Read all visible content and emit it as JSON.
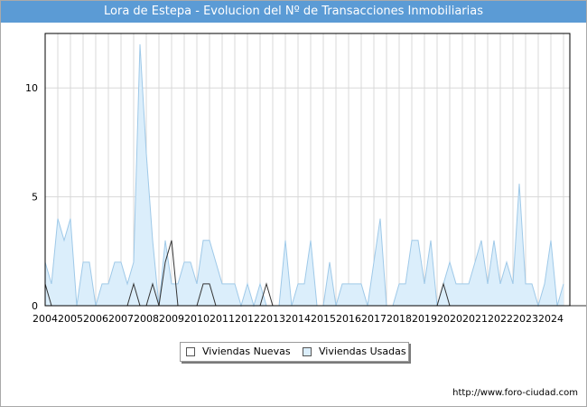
{
  "colors": {
    "title_bar": "#5b9bd5",
    "nuevas_line": "#333333",
    "usadas_fill": "#dbeefb",
    "usadas_line": "#9fc9e8",
    "grid": "#d8d8d8"
  },
  "chart_data": {
    "type": "area",
    "title": "Lora de Estepa - Evolucion del Nº de Transacciones Inmobiliarias",
    "xlabel": "",
    "ylabel": "",
    "ylim": [
      0,
      12.5
    ],
    "xlim": [
      2004,
      2024.75
    ],
    "grid": true,
    "legend_position": "bottom-center",
    "y_ticks": [
      "0",
      "5",
      "10"
    ],
    "x_ticks": [
      "2004",
      "2005",
      "2006",
      "2007",
      "2008",
      "2009",
      "2010",
      "2011",
      "2012",
      "2013",
      "2014",
      "2015",
      "2016",
      "2017",
      "2018",
      "2019",
      "2020",
      "2021",
      "2022",
      "2023",
      "2024"
    ],
    "x_start_year": 2004,
    "periods_per_year": 4,
    "series": [
      {
        "name": "Viviendas Nuevas",
        "values": [
          1,
          0,
          0,
          0,
          0,
          0,
          0,
          0,
          0,
          0,
          0,
          0,
          0,
          0,
          1,
          0,
          0,
          1,
          0,
          2,
          3,
          0,
          0,
          0,
          0,
          1,
          1,
          0,
          0,
          0,
          0,
          0,
          0,
          0,
          0,
          1,
          0,
          0,
          0,
          0,
          0,
          0,
          0,
          0,
          0,
          0,
          0,
          0,
          0,
          0,
          0,
          0,
          0,
          0,
          0,
          0,
          0,
          0,
          0,
          0,
          0,
          0,
          0,
          1,
          0,
          0,
          0,
          0,
          0,
          0,
          0,
          0,
          0,
          0,
          0,
          0,
          0,
          0,
          0,
          0,
          0,
          0,
          0,
          0,
          0,
          0,
          0,
          0,
          0,
          0,
          0,
          0,
          0,
          0,
          0
        ]
      },
      {
        "name": "Viviendas Usadas",
        "values": [
          2,
          1,
          4,
          3,
          4,
          0,
          2,
          2,
          0,
          1,
          1,
          2,
          2,
          1,
          2,
          12,
          7,
          3,
          0,
          3,
          1,
          1,
          2,
          2,
          1,
          3,
          3,
          2,
          1,
          1,
          1,
          0,
          1,
          0,
          1,
          0,
          0,
          0,
          3,
          0,
          1,
          1,
          3,
          0,
          0,
          2,
          0,
          1,
          1,
          1,
          1,
          0,
          2,
          4,
          0,
          0,
          1,
          1,
          3,
          3,
          1,
          3,
          0,
          1,
          2,
          1,
          1,
          1,
          2,
          3,
          1,
          3,
          1,
          2,
          1,
          5.6,
          1,
          1,
          0,
          1,
          3,
          0,
          1
        ]
      }
    ]
  },
  "legend": {
    "nuevas_label": "Viviendas Nuevas",
    "usadas_label": "Viviendas Usadas"
  },
  "footer": {
    "url": "http://www.foro-ciudad.com"
  }
}
